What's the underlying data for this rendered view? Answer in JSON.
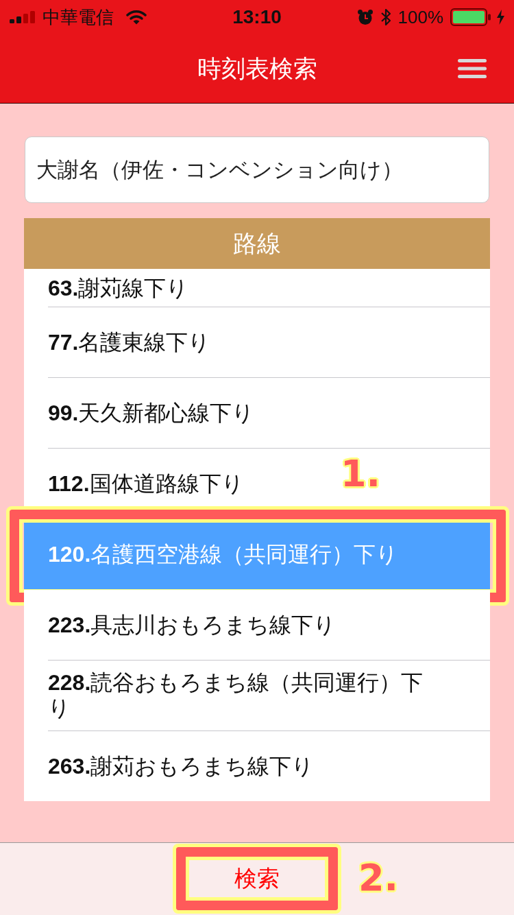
{
  "status_bar": {
    "carrier": "中華電信",
    "time": "13:10",
    "battery": "100%"
  },
  "header": {
    "title": "時刻表検索"
  },
  "stop_field": {
    "value": "大謝名（伊佐・コンベンション向け）"
  },
  "route_panel": {
    "heading": "路線",
    "routes": [
      {
        "label": "**63.**謝苅線下り",
        "selected": false,
        "clipped": true,
        "highlighted": false
      },
      {
        "label": "**77.**名護東線下り",
        "selected": false,
        "clipped": false,
        "highlighted": false
      },
      {
        "label": "**99.**天久新都心線下り",
        "selected": false,
        "clipped": false,
        "highlighted": false
      },
      {
        "label": "**112.**国体道路線下り",
        "selected": false,
        "clipped": false,
        "highlighted": false
      },
      {
        "label": "**120.**名護西空港線（共同運行）下り",
        "selected": true,
        "clipped": false,
        "highlighted": true,
        "callout": "1."
      },
      {
        "label": "**223.**具志川おもろまち線下り",
        "selected": false,
        "clipped": false,
        "highlighted": false
      },
      {
        "label": "**228.**読谷おもろまち線（共同運行）下り",
        "selected": false,
        "clipped": false,
        "highlighted": false
      },
      {
        "label": "**263.**謝苅おもろまち線下り",
        "selected": false,
        "clipped": false,
        "highlighted": false
      }
    ]
  },
  "footer": {
    "search_button": {
      "label": "検索",
      "highlighted": true,
      "callout": "2."
    }
  }
}
